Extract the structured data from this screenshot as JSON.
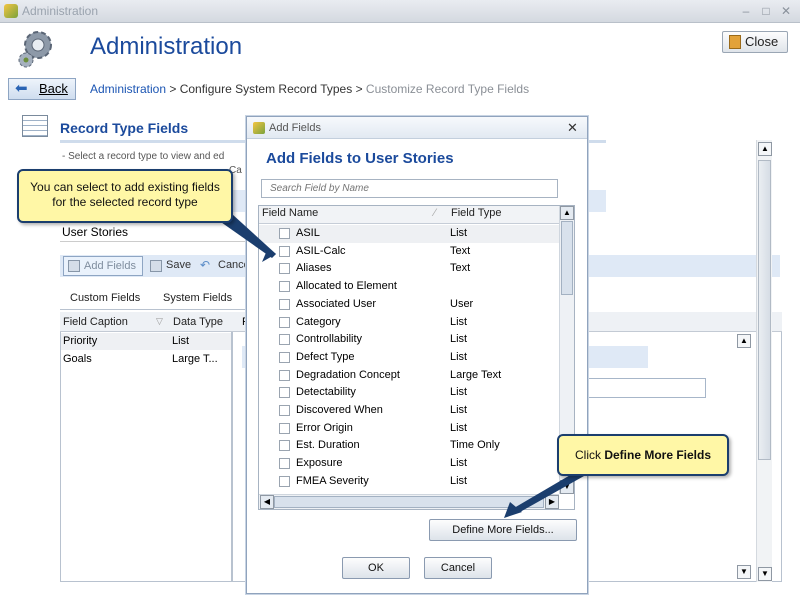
{
  "window": {
    "title": "Administration",
    "controls": [
      "–",
      "□",
      "✕"
    ]
  },
  "header": {
    "title": "Administration",
    "close_label": "Close"
  },
  "nav": {
    "back_label": "Back",
    "breadcrumb": [
      "Administration",
      " > Configure System Record Types > ",
      "Customize Record Type Fields"
    ]
  },
  "page": {
    "title": "Record Type Fields",
    "instructions_1": "-  Select a record type to view and ed",
    "instructions_2": "Ca",
    "record_type": "User Stories",
    "toolbar": {
      "add_fields": "Add Fields",
      "save": "Save",
      "cancel": "Cance"
    },
    "tabs": [
      "Custom Fields",
      "System Fields"
    ],
    "grid": {
      "columns": [
        "Field Caption",
        "Data Type"
      ],
      "rows": [
        [
          "Priority",
          "List"
        ],
        [
          "Goals",
          "Large T..."
        ]
      ]
    },
    "right_header": "F"
  },
  "dialog": {
    "title": "Add Fields",
    "heading": "Add Fields to User Stories",
    "search_placeholder": "Search Field by Name",
    "columns": [
      "Field Name",
      "Field Type"
    ],
    "fields": [
      [
        "ASIL",
        "List"
      ],
      [
        "ASIL-Calc",
        "Text"
      ],
      [
        "Aliases",
        "Text"
      ],
      [
        "Allocated to Element",
        ""
      ],
      [
        "Associated User",
        "User"
      ],
      [
        "Category",
        "List"
      ],
      [
        "Controllability",
        "List"
      ],
      [
        "Defect Type",
        "List"
      ],
      [
        "Degradation Concept",
        "Large Text"
      ],
      [
        "Detectability",
        "List"
      ],
      [
        "Discovered When",
        "List"
      ],
      [
        "Error Origin",
        "List"
      ],
      [
        "Est. Duration",
        "Time Only"
      ],
      [
        "Exposure",
        "List"
      ],
      [
        "FMEA Severity",
        "List"
      ],
      [
        "FMEA Severity",
        "List"
      ]
    ],
    "define_more": "Define More Fields...",
    "ok": "OK",
    "cancel": "Cancel"
  },
  "callouts": {
    "existing": "You can select to add existing fields for the selected record type",
    "define_prefix": "Click ",
    "define_bold": "Define More Fields"
  },
  "colors": {
    "accent": "#1b4a9c",
    "callout_bg": "#fff7a6",
    "callout_border": "#1b3e6e"
  }
}
